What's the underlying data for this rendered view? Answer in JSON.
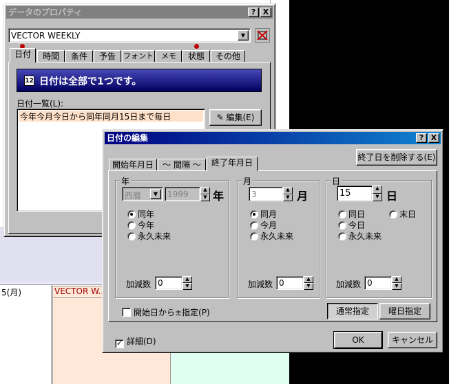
{
  "background": {
    "cal_date_label": "5(月)",
    "cal_event_label": "VECTOR W..."
  },
  "properties_dialog": {
    "title": "データのプロパティ",
    "help_btn": "?",
    "close_btn": "X",
    "selected_data": "VECTOR WEEKLY",
    "tabs": [
      "日付",
      "時間",
      "条件",
      "予告",
      "フォント",
      "メモ",
      "状態",
      "その他"
    ],
    "banner_icon": "12",
    "banner_text": "日付は全部で1つです。",
    "date_list_label": "日付一覧(L):",
    "date_list_items": [
      "今年今月今日から同年同月15日まで毎日"
    ],
    "edit_button": "編集(E)"
  },
  "edit_dialog": {
    "title": "日付の編集",
    "help_btn": "?",
    "close_btn": "X",
    "tabs": [
      "開始年月日",
      "～ 間隔 ～",
      "終了年月日"
    ],
    "active_tab": 2,
    "delete_end_button": "終了日を削除する(E)",
    "year": {
      "group_label": "年",
      "era_value": "西暦",
      "year_value": "1999",
      "unit": "年",
      "options": [
        "同年",
        "今年",
        "永久未来"
      ],
      "selected": 0,
      "adjust_label": "加減数",
      "adjust_value": "0"
    },
    "month": {
      "group_label": "月",
      "value": "3",
      "unit": "月",
      "options": [
        "同月",
        "今月",
        "永久未来"
      ],
      "selected": 0,
      "adjust_label": "加減数",
      "adjust_value": "0"
    },
    "day": {
      "group_label": "日",
      "value": "15",
      "unit": "日",
      "options": [
        "同日",
        "末日",
        "今日",
        "永久未来"
      ],
      "selected": -1,
      "adjust_label": "加減数",
      "adjust_value": "0"
    },
    "start_pm_label": "開始日から±指定(P)",
    "normal_button": "通常指定",
    "weekday_button": "曜日指定",
    "detail_label": "詳細(D)",
    "ok_button": "OK",
    "cancel_button": "キャンセル"
  }
}
